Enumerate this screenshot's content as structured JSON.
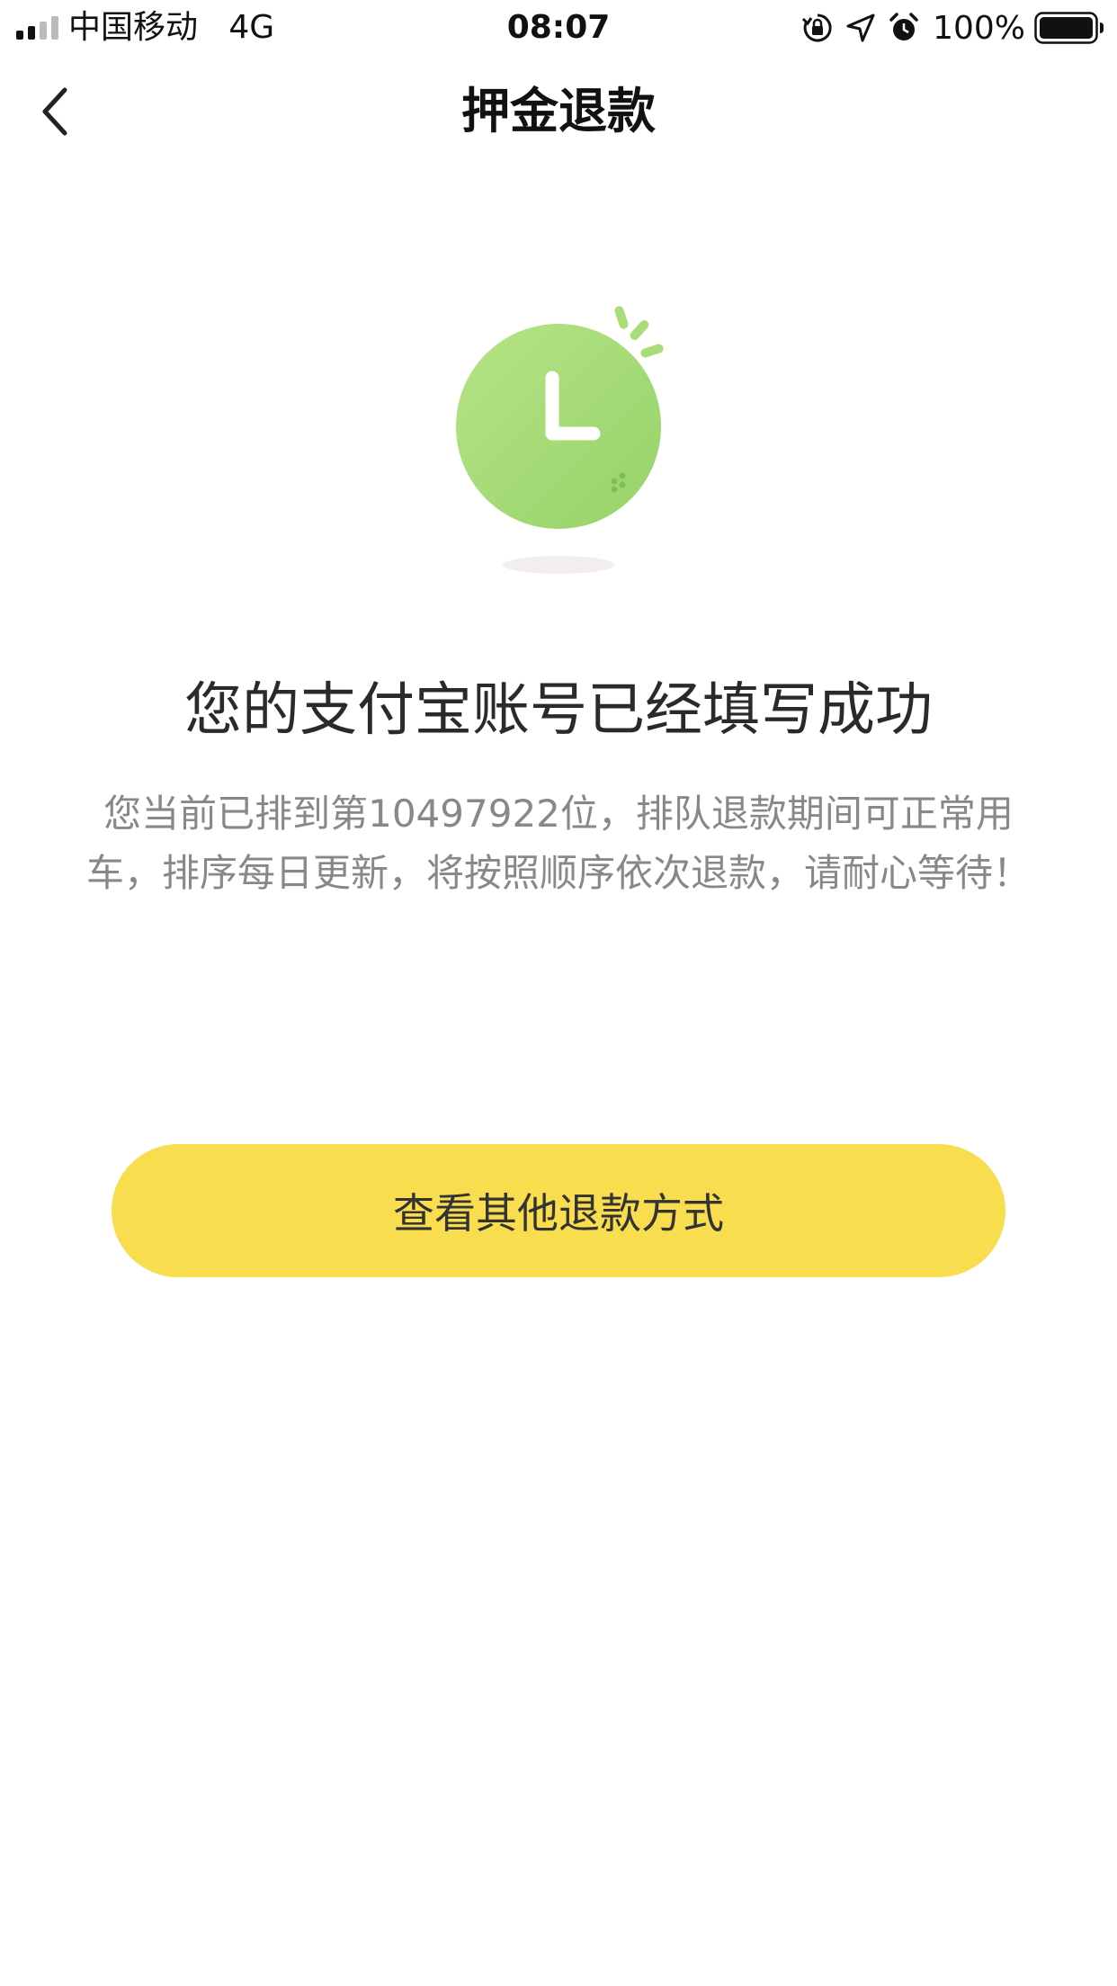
{
  "status_bar": {
    "carrier": "中国移动",
    "network": "4G",
    "time": "08:07",
    "battery_percent": "100%",
    "icons": [
      "signal-icon",
      "orientation-lock-icon",
      "location-icon",
      "alarm-icon",
      "battery-icon"
    ]
  },
  "nav": {
    "title": "押金退款",
    "back_icon": "chevron-left-icon"
  },
  "illustration": {
    "icon": "clock-icon",
    "colors": {
      "clock": "#a8dd78",
      "shadow": "#f2eeee"
    }
  },
  "message": {
    "heading": "您的支付宝账号已经填写成功",
    "description": "您当前已排到第10497922位，排队退款期间可正常用车，排序每日更新，将按照顺序依次退款，请耐心等待！"
  },
  "actions": {
    "other_refund_label": "查看其他退款方式",
    "button_color": "#f8dd4e"
  }
}
